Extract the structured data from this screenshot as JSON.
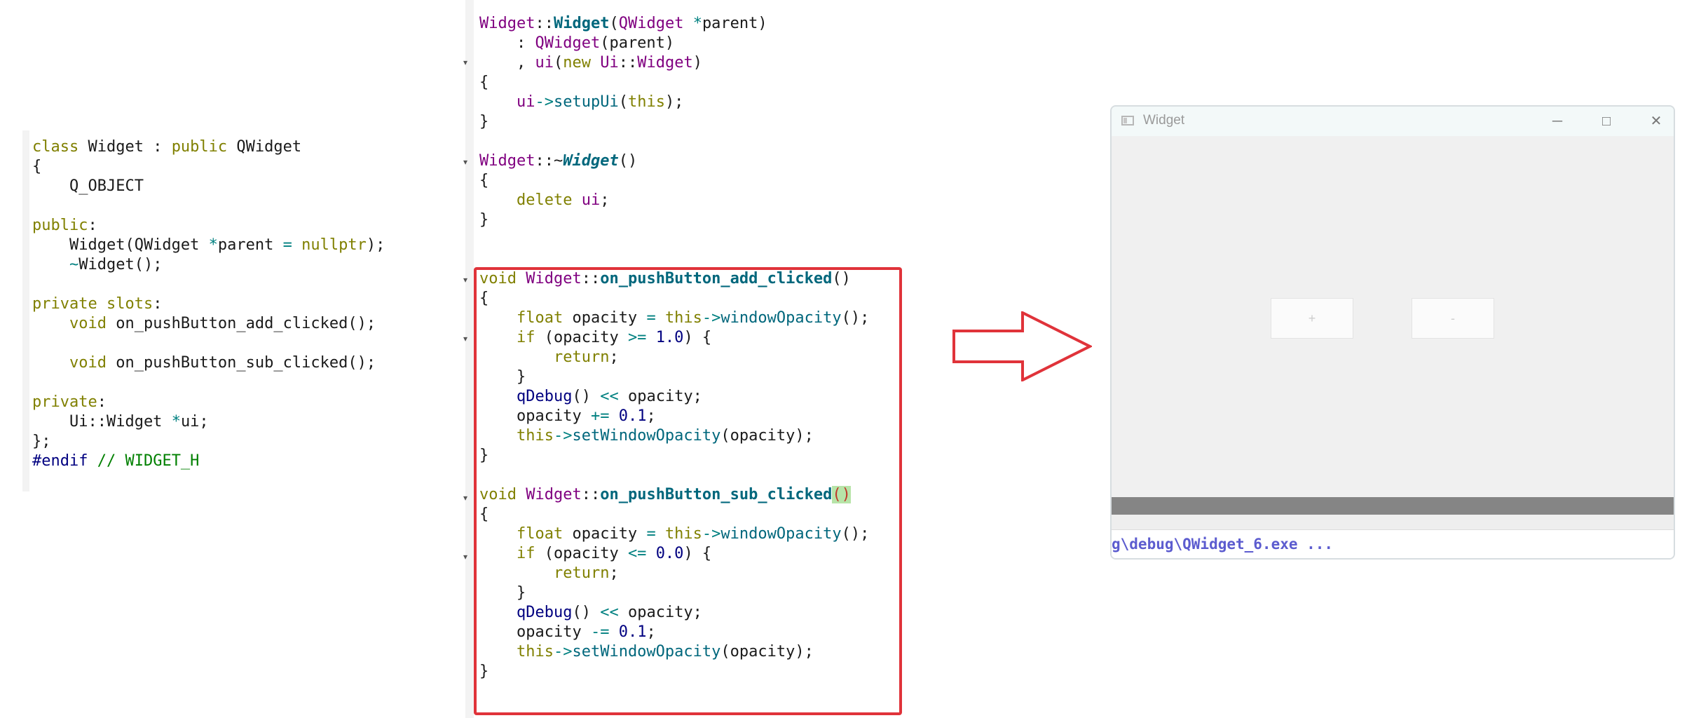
{
  "header_code": {
    "lines": [
      [
        {
          "t": "class",
          "c": "kw"
        },
        {
          "t": " Widget : "
        },
        {
          "t": "public",
          "c": "kw"
        },
        {
          "t": " QWidget"
        }
      ],
      [
        {
          "t": "{"
        }
      ],
      [
        {
          "t": "    Q_OBJECT"
        }
      ],
      [
        {
          "t": ""
        }
      ],
      [
        {
          "t": "public",
          "c": "kw"
        },
        {
          "t": ":"
        }
      ],
      [
        {
          "t": "    Widget(QWidget "
        },
        {
          "t": "*",
          "c": "op"
        },
        {
          "t": "parent "
        },
        {
          "t": "=",
          "c": "op"
        },
        {
          "t": " "
        },
        {
          "t": "nullptr",
          "c": "kw"
        },
        {
          "t": ");"
        }
      ],
      [
        {
          "t": "    "
        },
        {
          "t": "~",
          "c": "op"
        },
        {
          "t": "Widget();"
        }
      ],
      [
        {
          "t": ""
        }
      ],
      [
        {
          "t": "private",
          "c": "kw"
        },
        {
          "t": " "
        },
        {
          "t": "slots",
          "c": "kw"
        },
        {
          "t": ":"
        }
      ],
      [
        {
          "t": "    "
        },
        {
          "t": "void",
          "c": "kw"
        },
        {
          "t": " on_pushButton_add_clicked();"
        }
      ],
      [
        {
          "t": ""
        }
      ],
      [
        {
          "t": "    "
        },
        {
          "t": "void",
          "c": "kw"
        },
        {
          "t": " on_pushButton_sub_clicked();"
        }
      ],
      [
        {
          "t": ""
        }
      ],
      [
        {
          "t": "private",
          "c": "kw"
        },
        {
          "t": ":"
        }
      ],
      [
        {
          "t": "    Ui::Widget "
        },
        {
          "t": "*",
          "c": "op"
        },
        {
          "t": "ui;"
        }
      ],
      [
        {
          "t": "};"
        }
      ],
      [
        {
          "t": "#endif",
          "c": "pp"
        },
        {
          "t": " // WIDGET_H",
          "c": "cm"
        }
      ]
    ]
  },
  "source_code": {
    "lines": [
      [
        {
          "t": "Widget",
          "c": "ty"
        },
        {
          "t": "::"
        },
        {
          "t": "Widget",
          "c": "fnb"
        },
        {
          "t": "("
        },
        {
          "t": "QWidget",
          "c": "ty"
        },
        {
          "t": " "
        },
        {
          "t": "*",
          "c": "op"
        },
        {
          "t": "parent)"
        }
      ],
      [
        {
          "t": "    : "
        },
        {
          "t": "QWidget",
          "c": "ty"
        },
        {
          "t": "(parent)"
        }
      ],
      [
        {
          "t": "    , "
        },
        {
          "t": "ui",
          "c": "ty"
        },
        {
          "t": "("
        },
        {
          "t": "new",
          "c": "kw"
        },
        {
          "t": " "
        },
        {
          "t": "Ui",
          "c": "ty"
        },
        {
          "t": "::"
        },
        {
          "t": "Widget",
          "c": "ty"
        },
        {
          "t": ")"
        }
      ],
      [
        {
          "t": "{"
        }
      ],
      [
        {
          "t": "    "
        },
        {
          "t": "ui",
          "c": "ty"
        },
        {
          "t": "->",
          "c": "op"
        },
        {
          "t": "setupUi",
          "c": "fn"
        },
        {
          "t": "("
        },
        {
          "t": "this",
          "c": "kw"
        },
        {
          "t": ");"
        }
      ],
      [
        {
          "t": "}"
        }
      ],
      [
        {
          "t": ""
        }
      ],
      [
        {
          "t": "Widget",
          "c": "ty"
        },
        {
          "t": "::~"
        },
        {
          "t": "Widget",
          "c": "fnbi"
        },
        {
          "t": "()"
        }
      ],
      [
        {
          "t": "{"
        }
      ],
      [
        {
          "t": "    "
        },
        {
          "t": "delete",
          "c": "kw"
        },
        {
          "t": " "
        },
        {
          "t": "ui",
          "c": "ty"
        },
        {
          "t": ";"
        }
      ],
      [
        {
          "t": "}"
        }
      ],
      [
        {
          "t": ""
        }
      ],
      [
        {
          "t": ""
        }
      ],
      [
        {
          "t": "void",
          "c": "kw"
        },
        {
          "t": " "
        },
        {
          "t": "Widget",
          "c": "ty"
        },
        {
          "t": "::"
        },
        {
          "t": "on_pushButton_add_clicked",
          "c": "fnb"
        },
        {
          "t": "()"
        }
      ],
      [
        {
          "t": "{"
        }
      ],
      [
        {
          "t": "    "
        },
        {
          "t": "float",
          "c": "kw"
        },
        {
          "t": " opacity "
        },
        {
          "t": "=",
          "c": "op"
        },
        {
          "t": " "
        },
        {
          "t": "this",
          "c": "kw"
        },
        {
          "t": "->",
          "c": "op"
        },
        {
          "t": "windowOpacity",
          "c": "fn"
        },
        {
          "t": "();"
        }
      ],
      [
        {
          "t": "    "
        },
        {
          "t": "if",
          "c": "kw"
        },
        {
          "t": " (opacity "
        },
        {
          "t": ">=",
          "c": "op"
        },
        {
          "t": " "
        },
        {
          "t": "1.0",
          "c": "num"
        },
        {
          "t": ") {"
        }
      ],
      [
        {
          "t": "        "
        },
        {
          "t": "return",
          "c": "kw"
        },
        {
          "t": ";"
        }
      ],
      [
        {
          "t": "    }"
        }
      ],
      [
        {
          "t": "    "
        },
        {
          "t": "qDebug",
          "c": "pp"
        },
        {
          "t": "() "
        },
        {
          "t": "<<",
          "c": "op"
        },
        {
          "t": " opacity;"
        }
      ],
      [
        {
          "t": "    opacity "
        },
        {
          "t": "+=",
          "c": "op"
        },
        {
          "t": " "
        },
        {
          "t": "0.1",
          "c": "num"
        },
        {
          "t": ";"
        }
      ],
      [
        {
          "t": "    "
        },
        {
          "t": "this",
          "c": "kw"
        },
        {
          "t": "->",
          "c": "op"
        },
        {
          "t": "setWindowOpacity",
          "c": "fn"
        },
        {
          "t": "(opacity);"
        }
      ],
      [
        {
          "t": "}"
        }
      ],
      [
        {
          "t": ""
        }
      ],
      [
        {
          "t": "void",
          "c": "kw"
        },
        {
          "t": " "
        },
        {
          "t": "Widget",
          "c": "ty"
        },
        {
          "t": "::"
        },
        {
          "t": "on_pushButton_sub_clicked",
          "c": "fnb"
        },
        {
          "t": "()",
          "c": "hl"
        }
      ],
      [
        {
          "t": "{"
        }
      ],
      [
        {
          "t": "    "
        },
        {
          "t": "float",
          "c": "kw"
        },
        {
          "t": " opacity "
        },
        {
          "t": "=",
          "c": "op"
        },
        {
          "t": " "
        },
        {
          "t": "this",
          "c": "kw"
        },
        {
          "t": "->",
          "c": "op"
        },
        {
          "t": "windowOpacity",
          "c": "fn"
        },
        {
          "t": "();"
        }
      ],
      [
        {
          "t": "    "
        },
        {
          "t": "if",
          "c": "kw"
        },
        {
          "t": " (opacity "
        },
        {
          "t": "<=",
          "c": "op"
        },
        {
          "t": " "
        },
        {
          "t": "0.0",
          "c": "num"
        },
        {
          "t": ") {"
        }
      ],
      [
        {
          "t": "        "
        },
        {
          "t": "return",
          "c": "kw"
        },
        {
          "t": ";"
        }
      ],
      [
        {
          "t": "    }"
        }
      ],
      [
        {
          "t": "    "
        },
        {
          "t": "qDebug",
          "c": "pp"
        },
        {
          "t": "() "
        },
        {
          "t": "<<",
          "c": "op"
        },
        {
          "t": " opacity;"
        }
      ],
      [
        {
          "t": "    opacity "
        },
        {
          "t": "-=",
          "c": "op"
        },
        {
          "t": " "
        },
        {
          "t": "0.1",
          "c": "num"
        },
        {
          "t": ";"
        }
      ],
      [
        {
          "t": "    "
        },
        {
          "t": "this",
          "c": "kw"
        },
        {
          "t": "->",
          "c": "op"
        },
        {
          "t": "setWindowOpacity",
          "c": "fn"
        },
        {
          "t": "(opacity);"
        }
      ],
      [
        {
          "t": "}"
        }
      ]
    ]
  },
  "app_window": {
    "title": "Widget",
    "add_button_label": "+",
    "sub_button_label": "-",
    "output_path": "g\\debug\\QWidget_6.exe ..."
  },
  "colors": {
    "highlight_box": "#e0333a",
    "arrow": "#e0333a"
  }
}
